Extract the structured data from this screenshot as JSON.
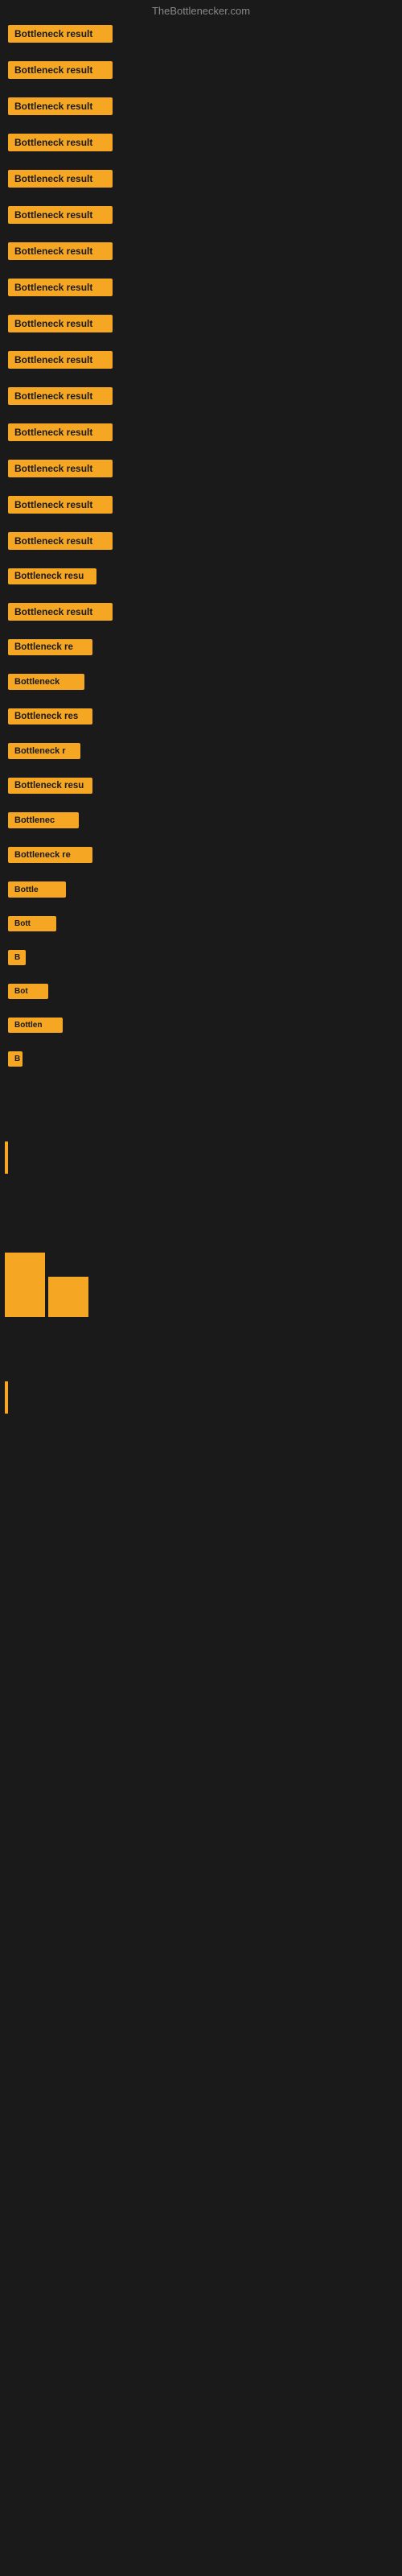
{
  "header": {
    "title": "TheBottlenecker.com"
  },
  "items": [
    {
      "id": 0,
      "label": "Bottleneck result"
    },
    {
      "id": 1,
      "label": "Bottleneck result"
    },
    {
      "id": 2,
      "label": "Bottleneck result"
    },
    {
      "id": 3,
      "label": "Bottleneck result"
    },
    {
      "id": 4,
      "label": "Bottleneck result"
    },
    {
      "id": 5,
      "label": "Bottleneck result"
    },
    {
      "id": 6,
      "label": "Bottleneck result"
    },
    {
      "id": 7,
      "label": "Bottleneck result"
    },
    {
      "id": 8,
      "label": "Bottleneck result"
    },
    {
      "id": 9,
      "label": "Bottleneck result"
    },
    {
      "id": 10,
      "label": "Bottleneck result"
    },
    {
      "id": 11,
      "label": "Bottleneck result"
    },
    {
      "id": 12,
      "label": "Bottleneck result"
    },
    {
      "id": 13,
      "label": "Bottleneck result"
    },
    {
      "id": 14,
      "label": "Bottleneck result"
    },
    {
      "id": 15,
      "label": "Bottleneck resu"
    },
    {
      "id": 16,
      "label": "Bottleneck result"
    },
    {
      "id": 17,
      "label": "Bottleneck re"
    },
    {
      "id": 18,
      "label": "Bottleneck"
    },
    {
      "id": 19,
      "label": "Bottleneck res"
    },
    {
      "id": 20,
      "label": "Bottleneck r"
    },
    {
      "id": 21,
      "label": "Bottleneck resu"
    },
    {
      "id": 22,
      "label": "Bottlenec"
    },
    {
      "id": 23,
      "label": "Bottleneck re"
    },
    {
      "id": 24,
      "label": "Bottle"
    },
    {
      "id": 25,
      "label": "Bott"
    },
    {
      "id": 26,
      "label": "B"
    },
    {
      "id": 27,
      "label": "Bot"
    },
    {
      "id": 28,
      "label": "Bottlen"
    },
    {
      "id": 29,
      "label": "B"
    }
  ]
}
